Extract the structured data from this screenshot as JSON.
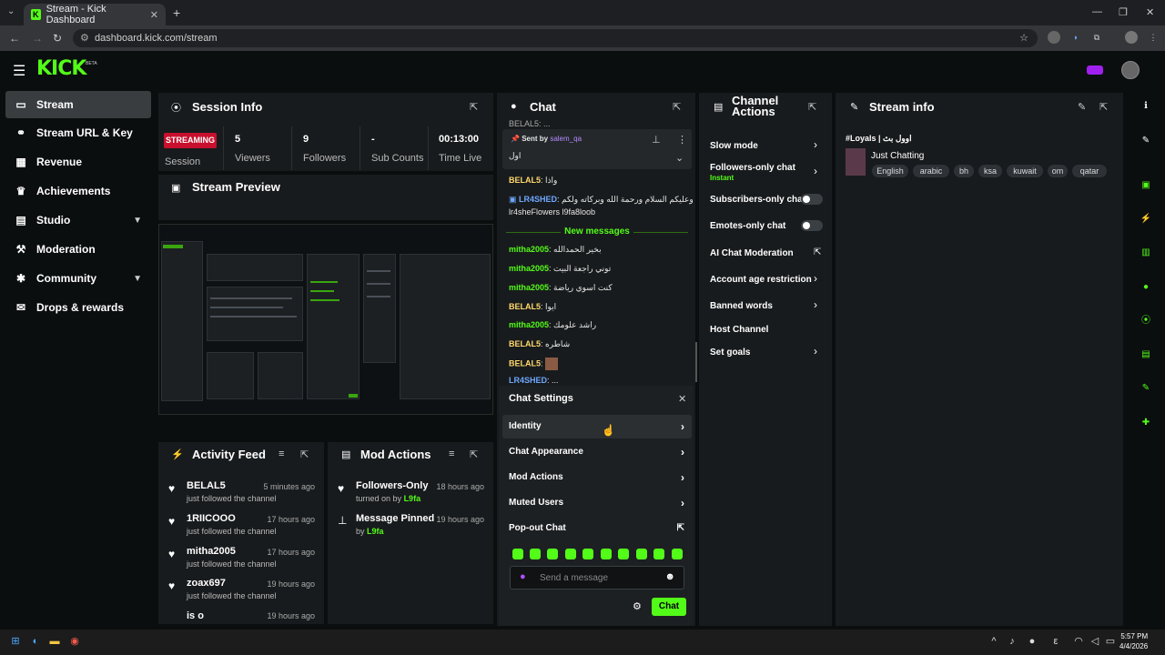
{
  "browser": {
    "tab_title": "Stream - Kick Dashboard",
    "url": "dashboard.kick.com/stream"
  },
  "brand": {
    "logo": "KICK",
    "beta": "BETA",
    "accent": "#53fc18"
  },
  "sidebar": {
    "items": [
      {
        "label": "Stream",
        "icon": "stream-icon"
      },
      {
        "label": "Stream URL & Key",
        "icon": "link-icon"
      },
      {
        "label": "Revenue",
        "icon": "chart-icon"
      },
      {
        "label": "Achievements",
        "icon": "trophy-icon"
      },
      {
        "label": "Studio",
        "icon": "studio-icon"
      },
      {
        "label": "Moderation",
        "icon": "hammer-icon"
      },
      {
        "label": "Community",
        "icon": "community-icon"
      },
      {
        "label": "Drops & rewards",
        "icon": "gift-icon"
      }
    ]
  },
  "session": {
    "title": "Session Info",
    "status": "STREAMING",
    "status_label": "Session",
    "viewers": "5",
    "viewers_label": "Viewers",
    "followers": "9",
    "followers_label": "Followers",
    "subs": "-",
    "subs_label": "Sub Counts",
    "time": "00:13:00",
    "time_label": "Time Live"
  },
  "preview": {
    "title": "Stream Preview"
  },
  "activity": {
    "title": "Activity Feed",
    "items": [
      {
        "name": "BELAL5",
        "sub": "just followed the channel",
        "time": "5 minutes ago"
      },
      {
        "name": "1RIICOOO",
        "sub": "just followed the channel",
        "time": "17 hours ago"
      },
      {
        "name": "mitha2005",
        "sub": "just followed the channel",
        "time": "17 hours ago"
      },
      {
        "name": "zoax697",
        "sub": "just followed the channel",
        "time": "19 hours ago"
      },
      {
        "name": "is o",
        "sub": "",
        "time": "19 hours ago"
      }
    ]
  },
  "mod_actions": {
    "title": "Mod Actions",
    "items": [
      {
        "name": "Followers-Only",
        "sub_prefix": "turned on by",
        "by": "L9fa",
        "time": "18 hours ago"
      },
      {
        "name": "Message Pinned",
        "sub_prefix": "by",
        "by": "L9fa",
        "time": "19 hours ago"
      }
    ]
  },
  "chat": {
    "title": "Chat",
    "pinned_top": "BELAL5: ...",
    "pinned_sent_by": "Sent by",
    "pinned_user": "salem_qa",
    "pinned_text": "اول",
    "messages_before": [
      {
        "user": "BELAL5",
        "text": "واذا",
        "color": "y"
      },
      {
        "user": "LR4SHED",
        "text": "وعليكم السلام ورحمة الله وبركاته ولكم",
        "color": "b"
      }
    ],
    "continued": "lr4sheFlowers l9fa8loob",
    "new_messages": "New messages",
    "messages_after": [
      {
        "user": "mitha2005",
        "text": "بخير الحمدالله",
        "color": "g"
      },
      {
        "user": "mitha2005",
        "text": "توني راجعة البيت",
        "color": "g"
      },
      {
        "user": "mitha2005",
        "text": "كنت اسوي رياضة",
        "color": "g"
      },
      {
        "user": "BELAL5",
        "text": "ايوا",
        "color": "y"
      },
      {
        "user": "mitha2005",
        "text": "راشد علومك",
        "color": "g"
      },
      {
        "user": "BELAL5",
        "text": "شاطره",
        "color": "y"
      },
      {
        "user": "BELAL5",
        "text": "",
        "color": "y"
      },
      {
        "user": "LR4SHED",
        "text": "...",
        "color": "b"
      }
    ]
  },
  "chat_settings": {
    "title": "Chat Settings",
    "items": [
      "Identity",
      "Chat Appearance",
      "Mod Actions",
      "Muted Users",
      "Pop-out Chat"
    ],
    "placeholder": "Send a message",
    "send": "Chat"
  },
  "channel_actions": {
    "title_line1": "Channel",
    "title_line2": "Actions",
    "items": [
      {
        "label": "Slow mode",
        "kind": "arrow"
      },
      {
        "label": "Followers-only chat",
        "sub": "Instant",
        "kind": "arrow"
      },
      {
        "label": "Subscribers-only chat",
        "kind": "toggle",
        "on": false
      },
      {
        "label": "Emotes-only chat",
        "kind": "toggle",
        "on": false
      },
      {
        "label": "AI Chat Moderation",
        "kind": "external"
      },
      {
        "label": "Account age restriction",
        "kind": "arrow"
      },
      {
        "label": "Banned words",
        "kind": "arrow"
      },
      {
        "label": "Host Channel",
        "kind": "none"
      },
      {
        "label": "Set goals",
        "kind": "arrow"
      }
    ]
  },
  "stream_info": {
    "title": "Stream info",
    "stream_title": "#Loyals | اوول بث",
    "category": "Just Chatting",
    "tags": [
      "English",
      "arabic",
      "bh",
      "ksa",
      "kuwait",
      "om",
      "qatar"
    ]
  },
  "taskbar": {
    "time": "5:57 PM",
    "date": "4/4/2026"
  }
}
